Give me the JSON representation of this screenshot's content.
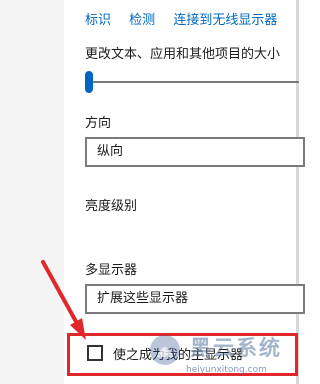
{
  "links": {
    "identify": "标识",
    "detect": "检测",
    "connect_wireless": "连接到无线显示器"
  },
  "scale": {
    "label": "更改文本、应用和其他项目的大小",
    "slider_level": 0.0
  },
  "orientation": {
    "label": "方向",
    "value": "纵向"
  },
  "brightness": {
    "label": "亮度级别"
  },
  "multiple_displays": {
    "label": "多显示器",
    "value": "扩展这些显示器"
  },
  "main_display": {
    "checkbox_label": "使之成为我的主显示器",
    "checked": false
  },
  "watermark": {
    "title": "黑云系统",
    "url": "heiyunxitong.com"
  },
  "colors": {
    "link": "#0067c0",
    "accent": "#0067c0",
    "highlight": "#e0272b"
  }
}
